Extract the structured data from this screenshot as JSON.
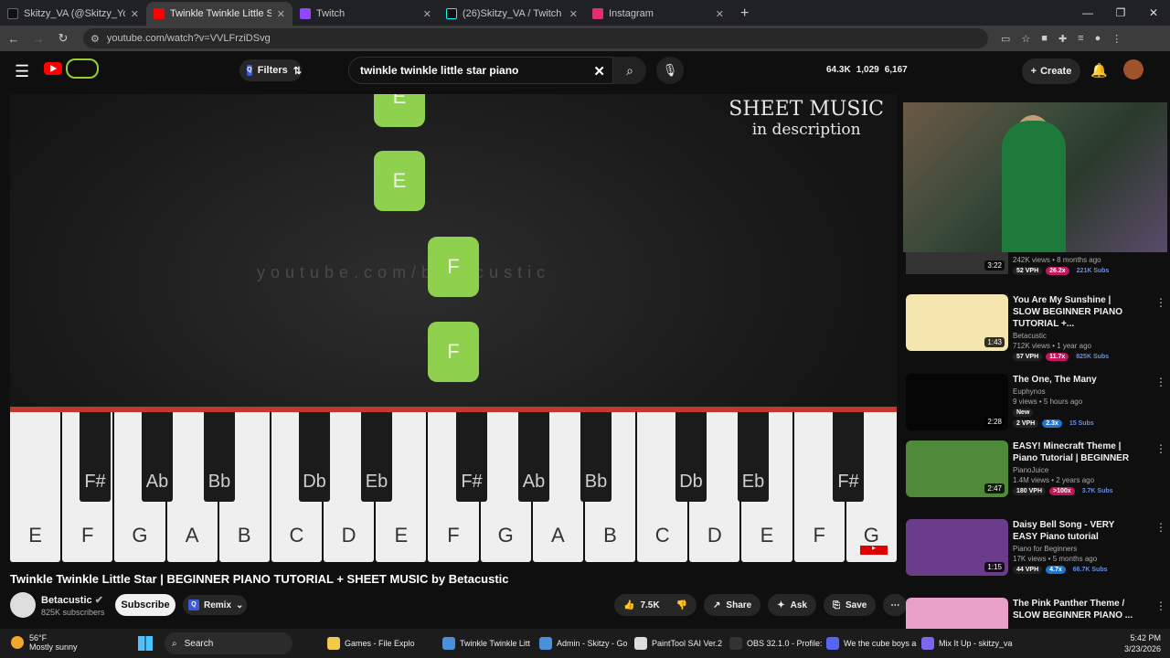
{
  "browser": {
    "tabs": [
      {
        "label": "Skitzy_VA (@Skitzy_Youtube) / X",
        "color": "#111111"
      },
      {
        "label": "Twinkle Twinkle Little Star | BEGINNER",
        "color": "#ff0000",
        "active": true
      },
      {
        "label": "Twitch",
        "color": "#9146ff"
      },
      {
        "label": "(26)Skitzy_VA / Twitch and YouTube",
        "color": "#111111"
      },
      {
        "label": "Instagram",
        "color": "#e1306c"
      }
    ],
    "url": "youtube.com/watch?v=VVLFrziDSvg"
  },
  "youtube": {
    "filters_label": "Filters",
    "search_value": "twinkle twinkle little star piano",
    "stats": [
      "64.3K",
      "1,029",
      "6,167"
    ],
    "create_label": "Create"
  },
  "player": {
    "sheet_line1": "SHEET MUSIC",
    "sheet_line2": "in description",
    "watermark": "youtube.com/betacustic",
    "notes": [
      "E",
      "E",
      "F",
      "F"
    ],
    "white_keys": [
      "E",
      "F",
      "G",
      "A",
      "B",
      "C",
      "D",
      "E",
      "F",
      "G",
      "A",
      "B",
      "C",
      "D",
      "E",
      "F",
      "G"
    ],
    "black_keys": [
      "F#",
      "Ab",
      "Bb",
      "Db",
      "Eb",
      "F#",
      "Ab",
      "Bb",
      "Db",
      "Eb",
      "F#"
    ]
  },
  "video": {
    "title": "Twinkle Twinkle Little Star | BEGINNER PIANO TUTORIAL + SHEET MUSIC by Betacustic",
    "channel": "Betacustic",
    "subscribers": "825K subscribers",
    "subscribe_label": "Subscribe",
    "remix_label": "Remix",
    "likes": "7.5K",
    "share_label": "Share",
    "ask_label": "Ask",
    "save_label": "Save"
  },
  "sidebar": {
    "first_meta": "242K views • 8 months ago",
    "first_dur": "3:22",
    "first_tags": [
      "52 VPH",
      "26.2x",
      "221K Subs"
    ],
    "videos": [
      {
        "title": "You Are My Sunshine | SLOW BEGINNER PIANO TUTORIAL +...",
        "channel": "Betacustic",
        "meta": "712K views • 1 year ago",
        "duration": "1:43",
        "tags": [
          "57 VPH",
          "11.7x",
          "825K Subs"
        ],
        "color": "#f5e6b0"
      },
      {
        "title": "The One, The Many",
        "channel": "Euphynos",
        "meta": "9 views • 5 hours ago",
        "duration": "2:28",
        "badge": "New",
        "tags": [
          "2 VPH",
          "2.3x",
          "15 Subs"
        ],
        "color": "#050505"
      },
      {
        "title": "EASY! Minecraft Theme | Piano Tutorial | BEGINNER",
        "channel": "PianoJuice",
        "meta": "1.4M views • 2 years ago",
        "duration": "2:47",
        "tags": [
          "180 VPH",
          ">100x",
          "3.7K Subs"
        ],
        "color": "#4f8a3a"
      },
      {
        "title": "Daisy Bell Song - VERY EASY Piano tutorial",
        "channel": "Piano for Beginners",
        "meta": "17K views • 5 months ago",
        "duration": "1:15",
        "tags": [
          "44 VPH",
          "4.7x",
          "66.7K Subs"
        ],
        "color": "#6a3c8a"
      },
      {
        "title": "The Pink Panther Theme / SLOW BEGINNER PIANO ...",
        "channel": "",
        "meta": "",
        "duration": "",
        "tags": [],
        "color": "#e8a0c8"
      }
    ]
  },
  "taskbar": {
    "temp": "56°F",
    "weather": "Mostly sunny",
    "search": "Search",
    "apps": [
      "Games - File Explo",
      "Twinkle Twinkle Litt",
      "Admin - Skitzy - Go",
      "PaintTool SAI Ver.2",
      "OBS 32.1.0 - Profile:",
      "We the cube boys a",
      "Mix It Up - skitzy_va"
    ],
    "time": "5:42 PM",
    "date": "3/23/2026"
  }
}
